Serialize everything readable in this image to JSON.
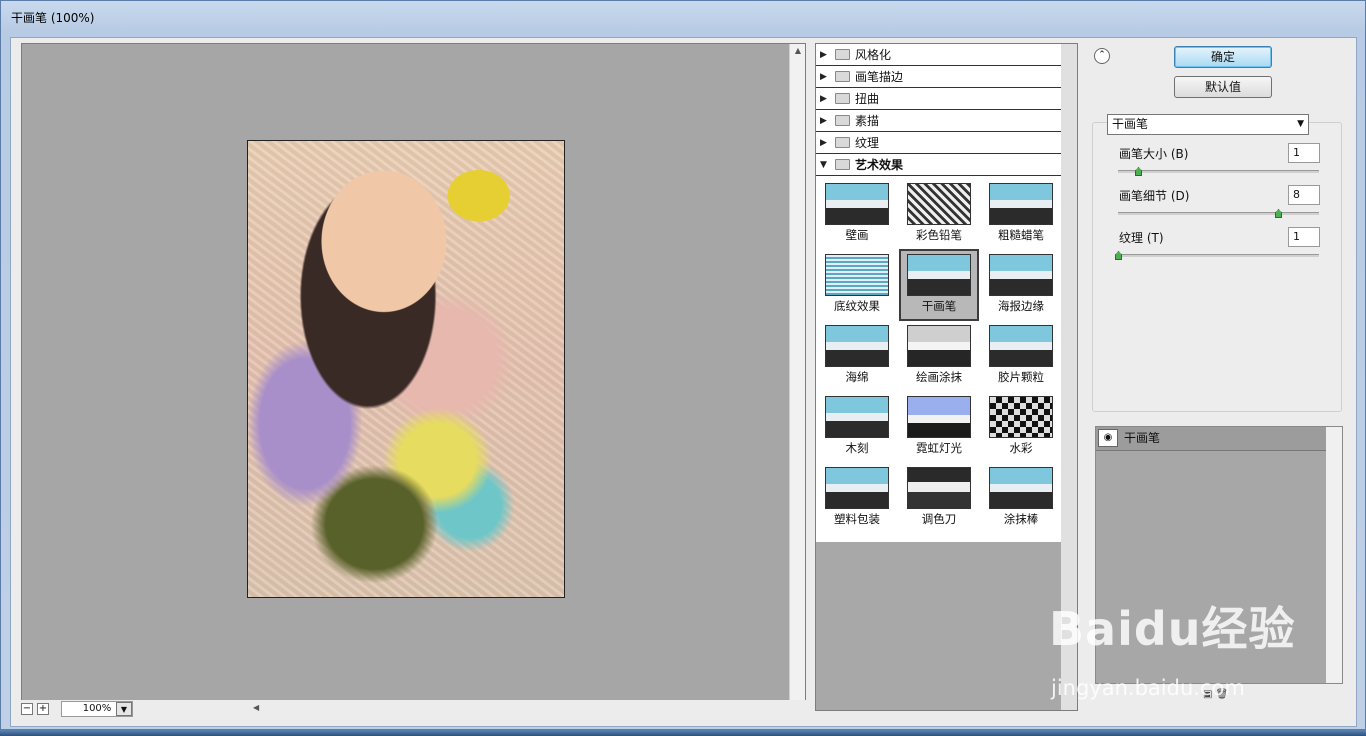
{
  "window": {
    "title": "干画笔 (100%)"
  },
  "preview": {
    "zoom_value": "100%"
  },
  "gallery": {
    "categories": [
      {
        "label": "风格化"
      },
      {
        "label": "画笔描边"
      },
      {
        "label": "扭曲"
      },
      {
        "label": "素描"
      },
      {
        "label": "纹理"
      },
      {
        "label": "艺术效果"
      }
    ],
    "thumbnails": [
      {
        "label": "壁画"
      },
      {
        "label": "彩色铅笔"
      },
      {
        "label": "粗糙蜡笔"
      },
      {
        "label": "底纹效果"
      },
      {
        "label": "干画笔"
      },
      {
        "label": "海报边缘"
      },
      {
        "label": "海绵"
      },
      {
        "label": "绘画涂抹"
      },
      {
        "label": "胶片颗粒"
      },
      {
        "label": "木刻"
      },
      {
        "label": "霓虹灯光"
      },
      {
        "label": "水彩"
      },
      {
        "label": "塑料包装"
      },
      {
        "label": "调色刀"
      },
      {
        "label": "涂抹棒"
      }
    ],
    "selected": "干画笔"
  },
  "buttons": {
    "ok": "确定",
    "default": "默认值"
  },
  "settings": {
    "filter_select": "干画笔",
    "params": [
      {
        "label": "画笔大小 (B)",
        "value": "1",
        "level": 0.1
      },
      {
        "label": "画笔细节 (D)",
        "value": "8",
        "level": 0.8
      },
      {
        "label": "纹理 (T)",
        "value": "1",
        "level": 0.0
      }
    ]
  },
  "layers": {
    "items": [
      {
        "name": "干画笔"
      }
    ]
  },
  "watermark": {
    "brand": "Baidu经验",
    "url": "jingyan.baidu.com"
  },
  "colors": {
    "ok_button": "#a9d9f2",
    "slider_thumb": "#4caf50",
    "preview_bg": "#a6a6a6"
  }
}
